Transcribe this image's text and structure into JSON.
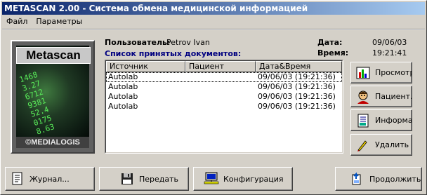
{
  "window": {
    "title": "METASCAN 2.00 - Система обмена медицинской информацией"
  },
  "menu": {
    "items": [
      "Файл",
      "Параметры"
    ]
  },
  "logo": {
    "title": "Metascan",
    "footer": "©MEDIALOGIS",
    "digits": [
      "1468",
      "3.27",
      "6712",
      "9381",
      "52.4",
      "0175",
      "8.63"
    ]
  },
  "info": {
    "user_label": "Пользователь:",
    "user_value": "Petrov Ivan",
    "date_label": "Дата:",
    "date_value": "09/06/03",
    "time_label": "Время:",
    "time_value": "19:21:41"
  },
  "list": {
    "title": "Список принятых документов:",
    "columns": [
      "Источник",
      "Пациент",
      "Дата&Время"
    ],
    "rows": [
      [
        "Autolab",
        "",
        "09/06/03 (19:21:36)"
      ],
      [
        "Autolab",
        "",
        "09/06/03 (19:21:36)"
      ],
      [
        "Autolab",
        "",
        "09/06/03 (19:21:36)"
      ],
      [
        "Autolab",
        "",
        "09/06/03 (19:21:36)"
      ]
    ]
  },
  "side_buttons": {
    "view": "Просмотр...",
    "patient": "Пациент...",
    "info": "Информация",
    "delete": "Удалить"
  },
  "bottom_buttons": {
    "journal": "Журнал...",
    "send": "Передать",
    "config": "Конфигурация",
    "continue": "Продолжить"
  }
}
